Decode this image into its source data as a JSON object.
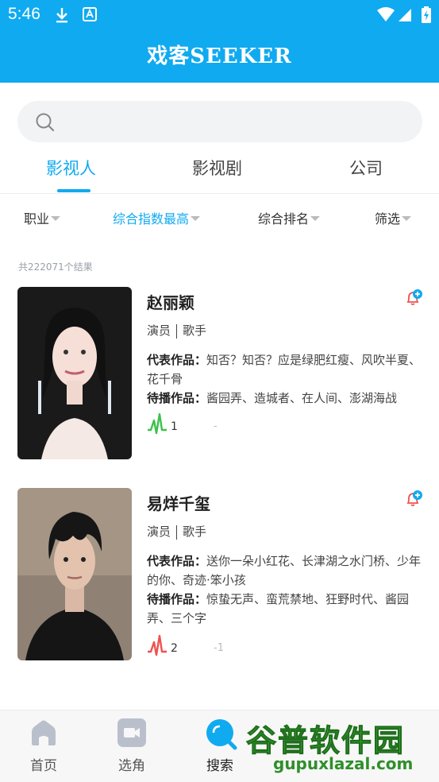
{
  "status_bar": {
    "time": "5:46"
  },
  "app": {
    "title": "戏客SEEKER"
  },
  "search": {
    "placeholder": ""
  },
  "tabs": [
    {
      "label": "影视人",
      "active": true
    },
    {
      "label": "影视剧",
      "active": false
    },
    {
      "label": "公司",
      "active": false
    }
  ],
  "filters": [
    {
      "label": "职业",
      "active": false
    },
    {
      "label": "综合指数最高",
      "active": true
    },
    {
      "label": "综合排名",
      "active": false
    },
    {
      "label": "筛选",
      "active": false
    }
  ],
  "result_count": "共222071个结果",
  "results": [
    {
      "name": "赵丽颖",
      "role1": "演员",
      "role2": "歌手",
      "works_label": "代表作品：",
      "works": "知否？知否？应是绿肥红瘦、风吹半夏、花千骨",
      "upcoming_label": "待播作品：",
      "upcoming": "酱园弄、造城者、在人间、澎湖海战",
      "rank": "1",
      "change": "-",
      "pulse_color": "#3cc24a"
    },
    {
      "name": "易烊千玺",
      "role1": "演员",
      "role2": "歌手",
      "works_label": "代表作品：",
      "works": "送你一朵小红花、长津湖之水门桥、少年的你、奇迹·笨小孩",
      "upcoming_label": "待播作品：",
      "upcoming": "惊蛰无声、蛮荒禁地、狂野时代、酱园弄、三个字",
      "rank": "2",
      "change": "-1",
      "pulse_color": "#f05050"
    }
  ],
  "bottom_nav": [
    {
      "label": "首页",
      "icon": "home-icon"
    },
    {
      "label": "选角",
      "icon": "video-icon"
    },
    {
      "label": "搜索",
      "icon": "search-icon",
      "active": true
    },
    {
      "label": "",
      "icon": ""
    },
    {
      "label": "",
      "icon": ""
    }
  ],
  "watermark": {
    "main": "谷普软件园",
    "url": "gupuxlazal.com"
  },
  "colors": {
    "accent": "#10aaf0",
    "up": "#3cc24a",
    "down": "#f05050"
  }
}
